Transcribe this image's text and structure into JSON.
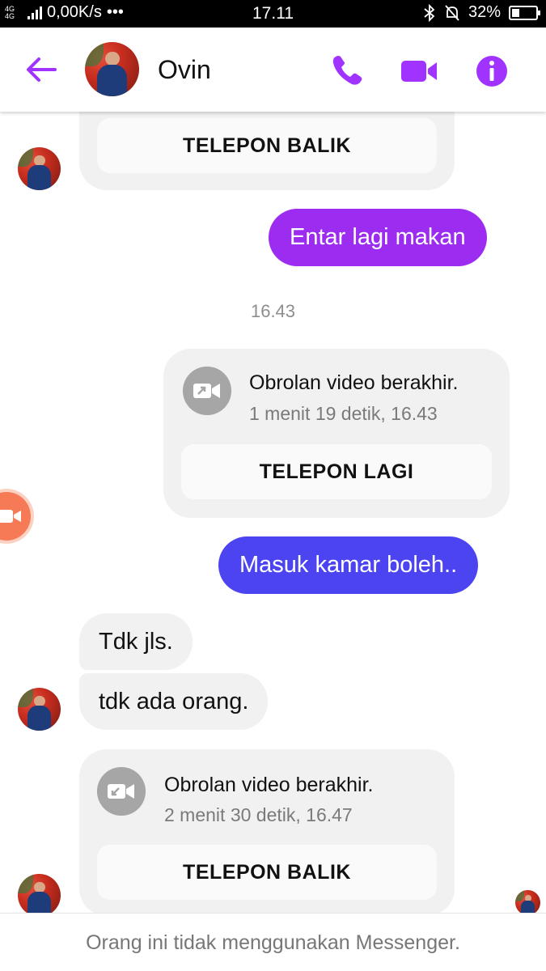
{
  "status_bar": {
    "network": "4G 4G",
    "speed": "0,00K/s",
    "more": "•••",
    "time": "17.11",
    "battery": "32%"
  },
  "header": {
    "contact_name": "Ovin",
    "accent_color": "#a033ff"
  },
  "messages": [
    {
      "type": "call_card_partial",
      "button": "TELEPON BALIK"
    },
    {
      "type": "outgoing",
      "text": "Entar lagi makan",
      "color": "#9b2cf0"
    },
    {
      "type": "timestamp",
      "text": "16.43"
    },
    {
      "type": "call_card_outgoing",
      "title": "Obrolan video berakhir.",
      "subtitle": "1 menit 19 detik, 16.43",
      "button": "TELEPON LAGI",
      "icon": "video-call-outgoing-icon"
    },
    {
      "type": "outgoing",
      "text": "Masuk kamar boleh..",
      "color": "#4b44f0"
    },
    {
      "type": "incoming",
      "text": "Tdk jls."
    },
    {
      "type": "incoming",
      "text": "tdk ada orang."
    },
    {
      "type": "call_card_incoming",
      "title": "Obrolan video berakhir.",
      "subtitle": "2 menit 30 detik, 16.47",
      "button": "TELEPON BALIK",
      "icon": "video-call-incoming-icon"
    }
  ],
  "footer": {
    "notice": "Orang ini tidak menggunakan Messenger."
  }
}
